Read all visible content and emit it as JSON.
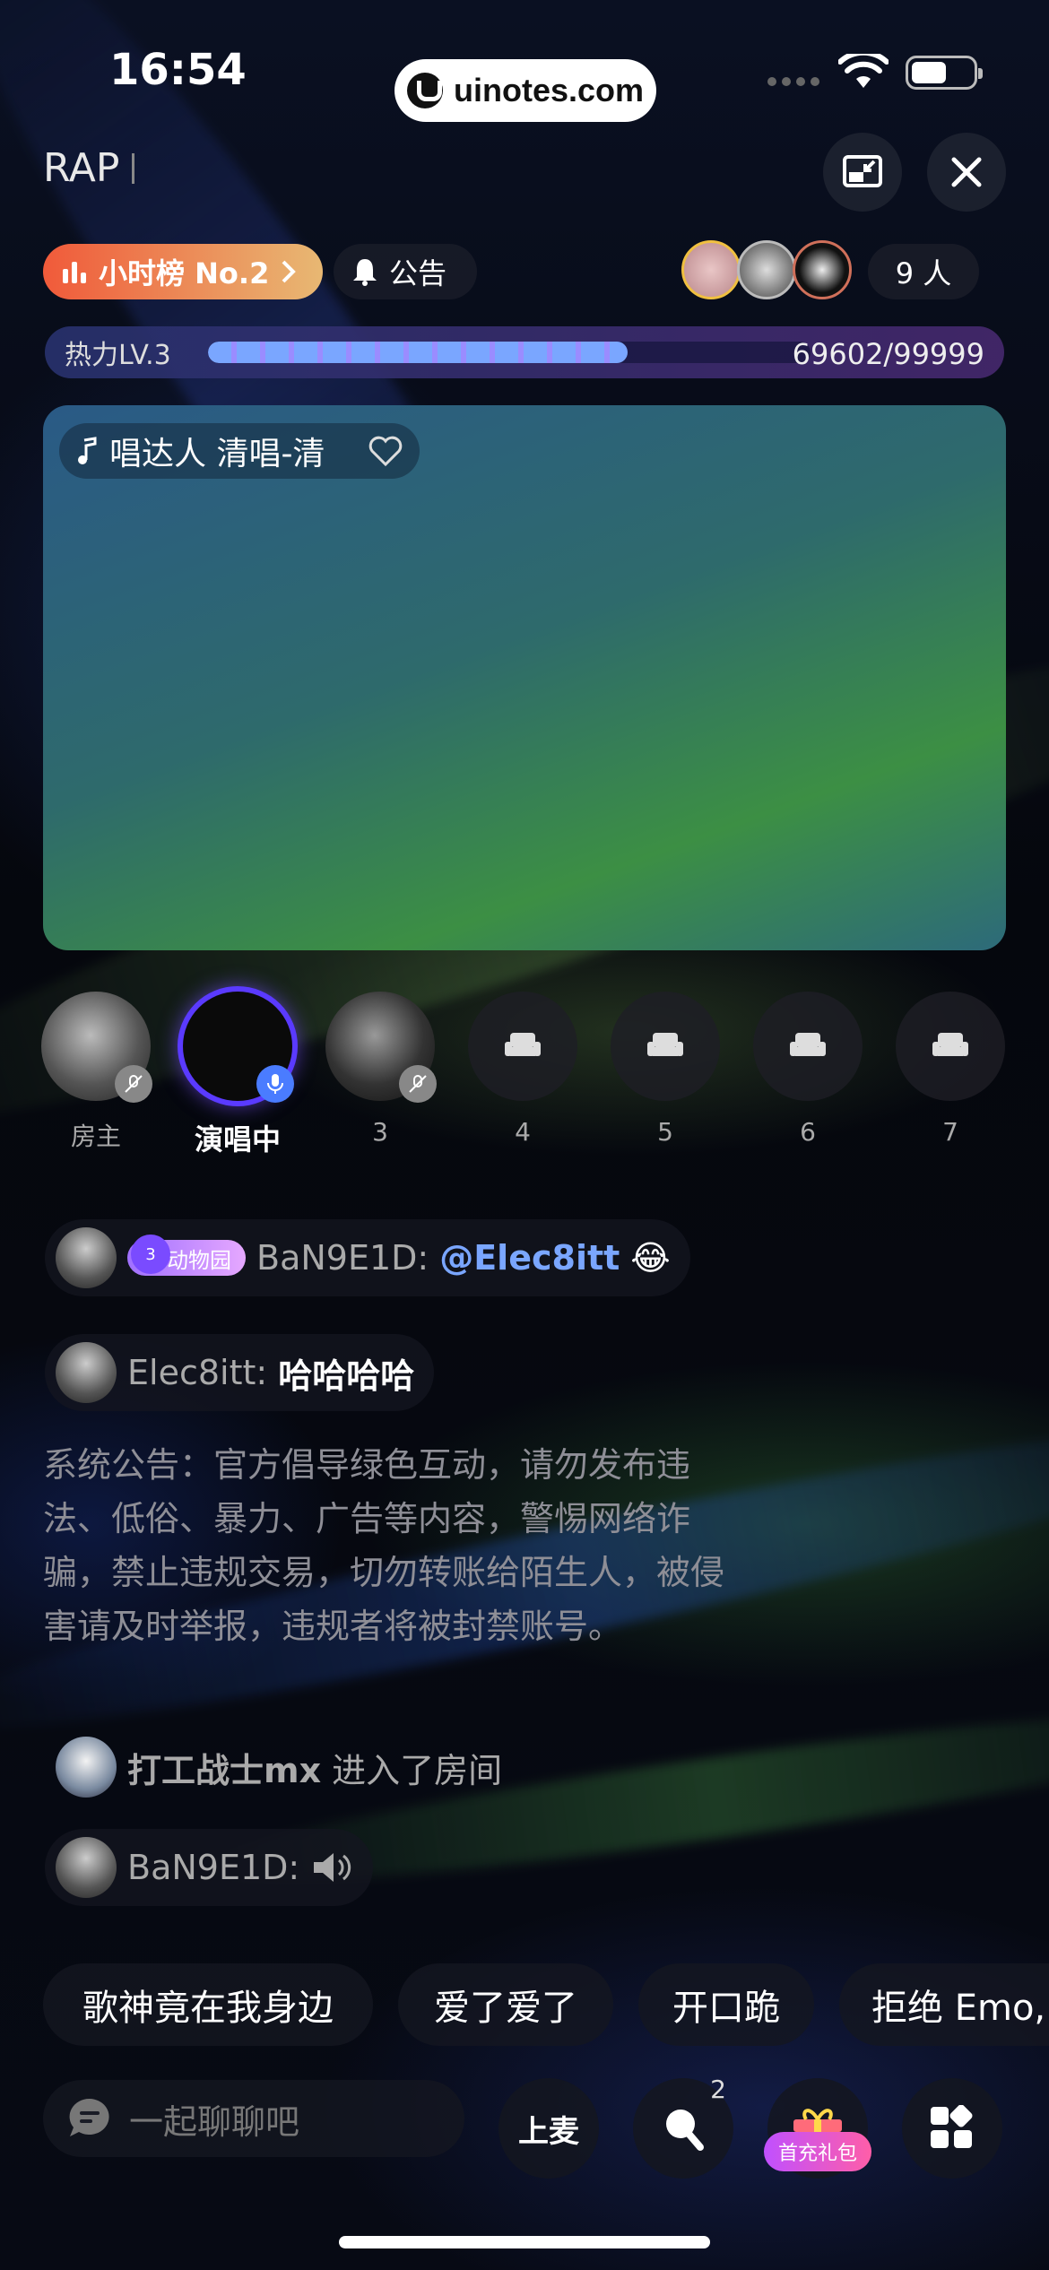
{
  "status_bar": {
    "time": "16:54",
    "watermark": "uinotes.com"
  },
  "header": {
    "room_name": "RAP"
  },
  "rank": {
    "label": "小时榜 No.2"
  },
  "notice": {
    "label": "公告"
  },
  "audience": {
    "count_label": "9 人"
  },
  "heat": {
    "label": "热力LV.3",
    "value": "69602/99999",
    "progress": 0.696
  },
  "stage": {
    "song": "唱达人  清唱-清"
  },
  "seats": [
    {
      "label": "房主",
      "state": "muted"
    },
    {
      "label": "演唱中",
      "state": "singing"
    },
    {
      "label": "3",
      "state": "muted"
    },
    {
      "label": "4",
      "state": "empty"
    },
    {
      "label": "5",
      "state": "empty"
    },
    {
      "label": "6",
      "state": "empty"
    },
    {
      "label": "7",
      "state": "empty"
    }
  ],
  "chat": {
    "msg1": {
      "badge_level": "3",
      "badge_label": "动物园",
      "name": "BaN9E1D:",
      "mention": "@Elec8itt",
      "emoji": "😂"
    },
    "msg2": {
      "name": "Elec8itt:",
      "text": "哈哈哈哈"
    },
    "system": "系统公告：官方倡导绿色互动，请勿发布违法、低俗、暴力、广告等内容，警惕网络诈骗，禁止违规交易，切勿转账给陌生人，被侵害请及时举报，违规者将被封禁账号。",
    "enter": {
      "name": "打工战士mx",
      "text": "进入了房间"
    },
    "msg3": {
      "name": "BaN9E1D:"
    }
  },
  "quick_replies": [
    "歌神竟在我身边",
    "爱了爱了",
    "开口跪",
    "拒绝 Emo,"
  ],
  "bottom": {
    "input_placeholder": "一起聊聊吧",
    "mic_label": "上麦",
    "search_badge": "2",
    "gift_label": "首充礼包"
  }
}
